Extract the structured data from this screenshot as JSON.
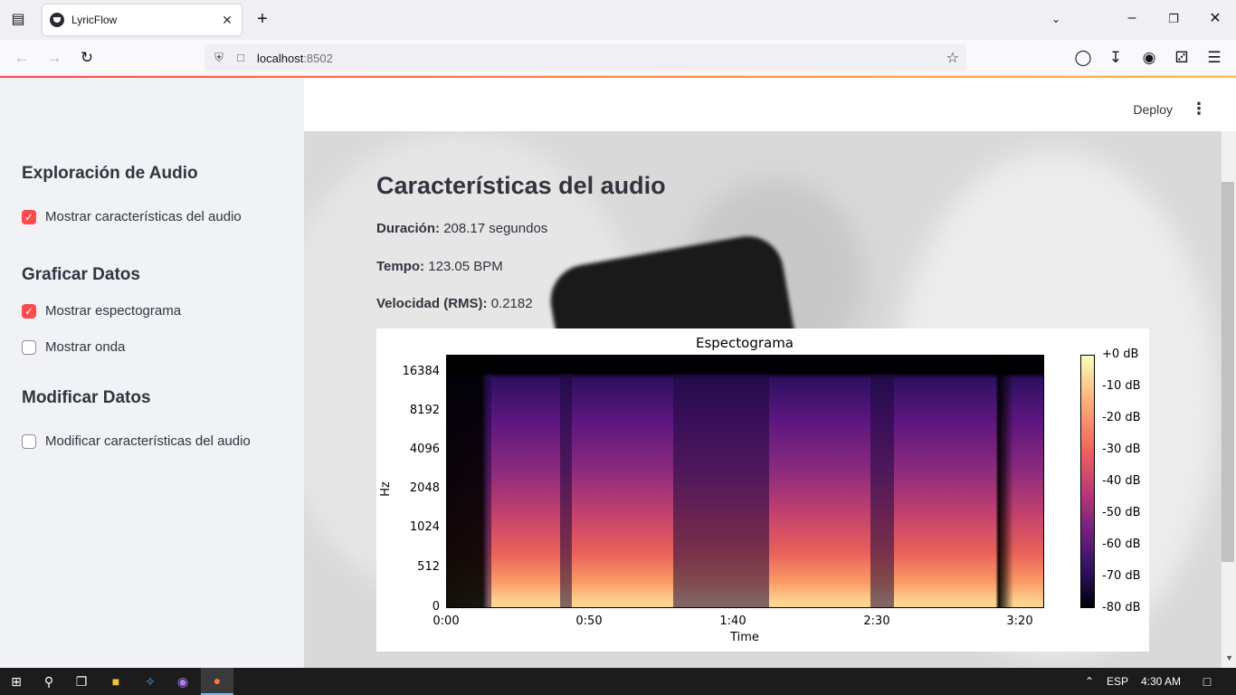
{
  "browser": {
    "tab_title": "LyricFlow",
    "url_host": "localhost",
    "url_port": ":8502"
  },
  "app": {
    "deploy_label": "Deploy",
    "menu_icon": "kebab-menu-icon"
  },
  "sidebar": {
    "sections": [
      {
        "heading": "Exploración de Audio"
      },
      {
        "heading": "Graficar Datos"
      },
      {
        "heading": "Modificar Datos"
      }
    ],
    "checkboxes": [
      {
        "label": "Mostrar características del audio",
        "checked": true
      },
      {
        "label": "Mostrar espectograma",
        "checked": true
      },
      {
        "label": "Mostrar onda",
        "checked": false
      },
      {
        "label": "Modificar características del audio",
        "checked": false
      }
    ]
  },
  "main": {
    "title": "Características del audio",
    "features": [
      {
        "key": "Duración:",
        "value": "208.17 segundos"
      },
      {
        "key": "Tempo:",
        "value": "123.05 BPM"
      },
      {
        "key": "Velocidad (RMS):",
        "value": "0.2182"
      }
    ]
  },
  "chart_data": {
    "type": "heatmap",
    "title": "Espectograma",
    "xlabel": "Time",
    "ylabel": "Hz",
    "x_ticks": [
      "0:00",
      "0:50",
      "1:40",
      "2:30",
      "3:20"
    ],
    "y_ticks": [
      "0",
      "512",
      "1024",
      "2048",
      "4096",
      "8192",
      "16384"
    ],
    "colorbar_ticks": [
      "+0 dB",
      "-10 dB",
      "-20 dB",
      "-30 dB",
      "-40 dB",
      "-50 dB",
      "-60 dB",
      "-70 dB",
      "-80 dB"
    ],
    "colormap": "magma",
    "y_scale": "log",
    "duration_seconds": 208.17
  },
  "taskbar": {
    "language": "ESP",
    "time": "4:30 AM"
  },
  "colors": {
    "accent": "#ff4b4b",
    "sidebar_bg": "#f0f2f6",
    "text": "#31333f"
  }
}
